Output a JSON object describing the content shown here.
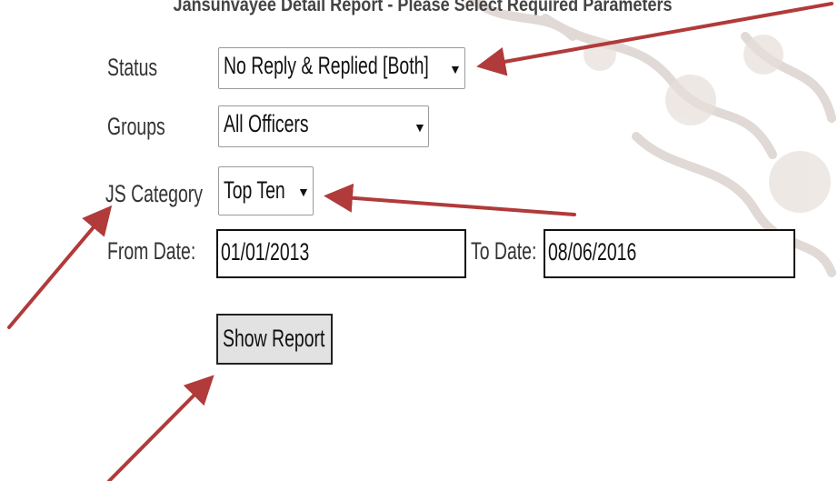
{
  "title": "Jansunvayee Detail Report - Please Select Required Parameters",
  "form": {
    "status": {
      "label": "Status",
      "value": "No Reply & Replied [Both]"
    },
    "groups": {
      "label": "Groups",
      "value": "All Officers"
    },
    "category": {
      "label": "JS Category",
      "value": "Top Ten"
    },
    "from_date": {
      "label": "From Date:",
      "value": "01/01/2013"
    },
    "to_date": {
      "label": "To Date:",
      "value": "08/06/2016"
    },
    "submit_label": "Show Report"
  },
  "icons": {
    "caret": "▼"
  },
  "colors": {
    "annotation_arrow": "#b13a3a",
    "button_bg": "#e2e2e2"
  }
}
